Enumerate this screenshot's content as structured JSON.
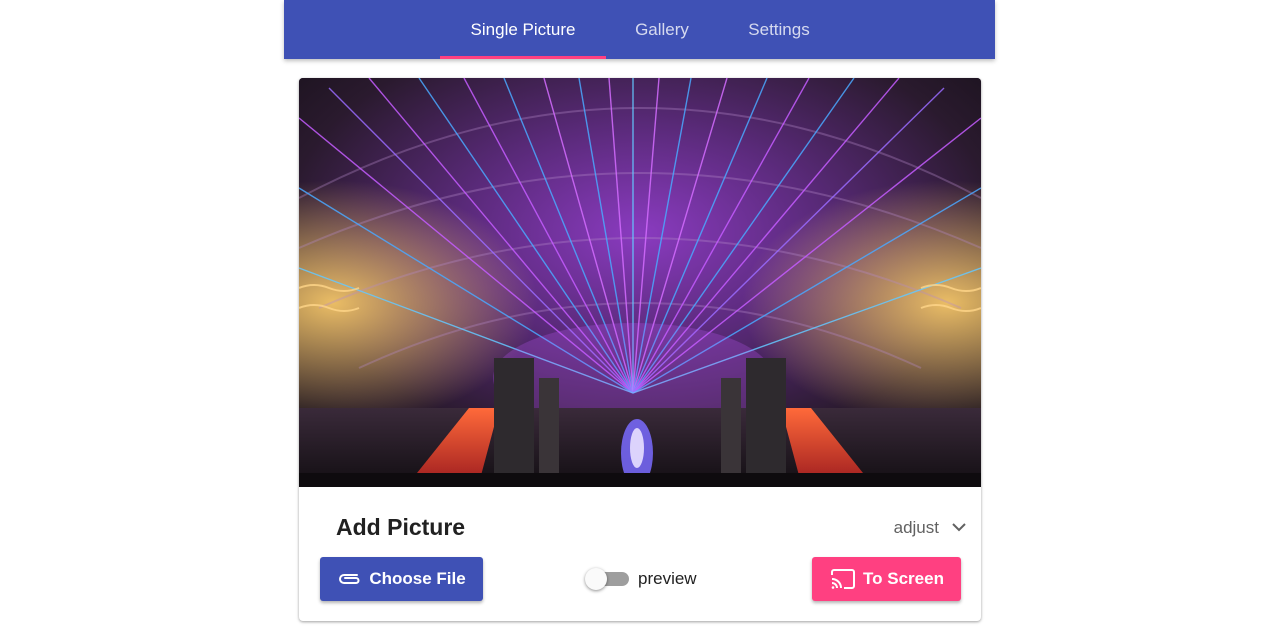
{
  "tabs": [
    {
      "label": "Single Picture",
      "active": true
    },
    {
      "label": "Gallery",
      "active": false
    },
    {
      "label": "Settings",
      "active": false
    }
  ],
  "colors": {
    "primary": "#3f51b5",
    "accent": "#ff4081",
    "toggle_off": "#9e9e9e"
  },
  "picture": {
    "icon": "laser-show-photo"
  },
  "card": {
    "title": "Add Picture",
    "adjust_label": "adjust",
    "adjust_icon": "chevron-down-icon"
  },
  "actions": {
    "choose_file_label": "Choose File",
    "choose_file_icon": "paperclip-icon",
    "preview_label": "preview",
    "preview_enabled": false,
    "to_screen_label": "To Screen",
    "to_screen_icon": "cast-icon"
  }
}
